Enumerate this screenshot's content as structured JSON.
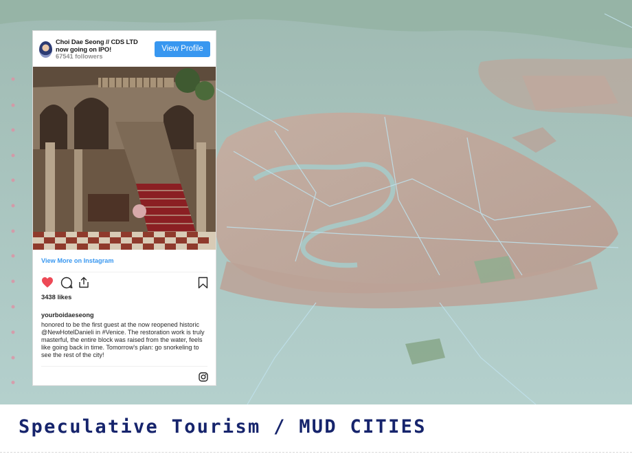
{
  "post": {
    "author": "Choi Dae Seong // CDS LTD now going on IPO!",
    "followers": "67541 followers",
    "view_profile_label": "View Profile",
    "view_more_label": "View More on Instagram",
    "likes": "3438 likes",
    "username": "yourboidaeseong",
    "caption": "honored to be the first guest at the now reopened historic @NewHotelDanieli in #Venice. The restoration work is truly masterful, the entire block was raised from the water, feels like going back in time. Tomorrow's plan: go snorkeling to see the rest of the city!"
  },
  "icons": {
    "like": "heart-icon",
    "comment": "comment-icon",
    "share": "share-icon",
    "save": "bookmark-icon",
    "instagram": "instagram-icon"
  },
  "colors": {
    "accent": "#3897f0",
    "heart": "#ed4956",
    "title": "#16246c",
    "water": "#a9c7c4"
  },
  "footer": {
    "title": "Speculative Tourism / MUD CITIES"
  }
}
